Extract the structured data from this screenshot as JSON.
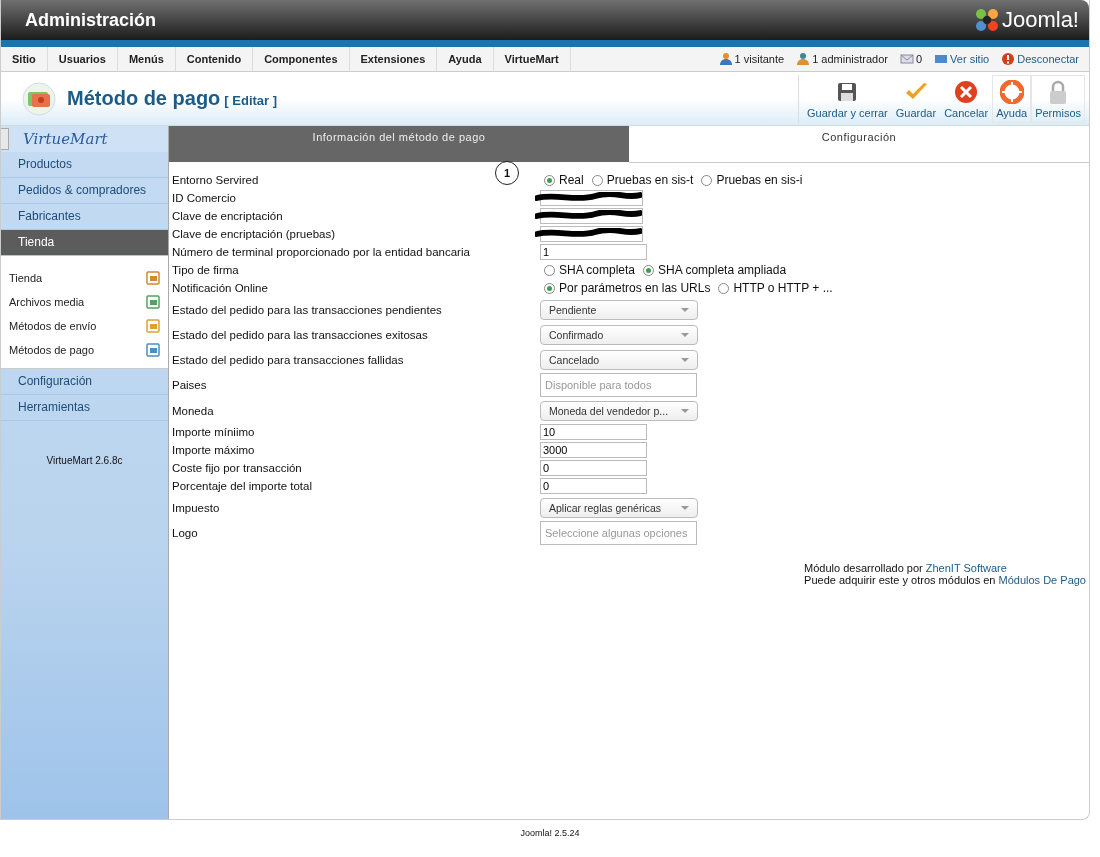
{
  "header": {
    "title": "Administración",
    "logo": "Joomla!"
  },
  "menu": [
    {
      "label": "Sitio"
    },
    {
      "label": "Usuarios"
    },
    {
      "label": "Menús"
    },
    {
      "label": "Contenido"
    },
    {
      "label": "Componentes"
    },
    {
      "label": "Extensiones"
    },
    {
      "label": "Ayuda"
    },
    {
      "label": "VirtueMart"
    }
  ],
  "status": [
    {
      "kind": "users",
      "label": "1 visitante"
    },
    {
      "kind": "admins",
      "label": "1 administrador"
    },
    {
      "kind": "messages",
      "label": "0"
    },
    {
      "kind": "site",
      "label": "Ver sitio"
    },
    {
      "kind": "logout",
      "label": "Desconectar"
    }
  ],
  "toolbar": {
    "title": "Método de pago",
    "subtitle": "[ Editar ]",
    "buttons": [
      {
        "kind": "save-close",
        "label": "Guardar y cerrar"
      },
      {
        "kind": "save",
        "label": "Guardar"
      },
      {
        "kind": "cancel",
        "label": "Cancelar"
      },
      {
        "kind": "help",
        "label": "Ayuda"
      },
      {
        "kind": "permissions",
        "label": "Permisos"
      }
    ]
  },
  "sidebar": {
    "logo": "VirtueMart",
    "items": [
      {
        "label": "Productos",
        "selected": false
      },
      {
        "label": "Pedidos & compradores",
        "selected": false
      },
      {
        "label": "Fabricantes",
        "selected": false
      },
      {
        "label": "Tienda",
        "selected": true,
        "children": [
          {
            "label": "Tienda",
            "kind": "store"
          },
          {
            "label": "Archivos media",
            "kind": "media"
          },
          {
            "label": "Métodos de envío",
            "kind": "shipping"
          },
          {
            "label": "Métodos de pago",
            "kind": "payment"
          }
        ]
      },
      {
        "label": "Configuración",
        "selected": false
      },
      {
        "label": "Herramientas",
        "selected": false
      }
    ],
    "version": "VirtueMart 2.6.8c"
  },
  "tabs": [
    {
      "label": "Información del método de pago",
      "selected": true
    },
    {
      "label": "Configuración",
      "selected": false
    }
  ],
  "annotation": "1",
  "form": [
    {
      "label": "Entorno Servired",
      "kind": "radio",
      "options": [
        {
          "label": "Real",
          "selected": true
        },
        {
          "label": "Pruebas en sis-t",
          "selected": false
        },
        {
          "label": "Pruebas en sis-i",
          "selected": false
        }
      ]
    },
    {
      "label": "ID Comercio",
      "kind": "redacted"
    },
    {
      "label": "Clave de encriptación",
      "kind": "redacted"
    },
    {
      "label": "Clave de encriptación (pruebas)",
      "kind": "redacted"
    },
    {
      "label": "Número de terminal proporcionado por la entidad bancaria",
      "kind": "text",
      "value": "1"
    },
    {
      "label": "Tipo de firma",
      "kind": "radio",
      "options": [
        {
          "label": "SHA completa",
          "selected": false
        },
        {
          "label": "SHA completa ampliada",
          "selected": true
        }
      ]
    },
    {
      "label": "Notificación Online",
      "kind": "radio",
      "options": [
        {
          "label": "Por parámetros en las URLs",
          "selected": true
        },
        {
          "label": "HTTP o HTTP + ...",
          "selected": false
        }
      ]
    },
    {
      "label": "Estado del pedido para las transacciones pendientes",
      "kind": "select",
      "value": "Pendiente"
    },
    {
      "label": "Estado del pedido para las transacciones exitosas",
      "kind": "select",
      "value": "Confirmado"
    },
    {
      "label": "Estado del pedido para transacciones fallidas",
      "kind": "select",
      "value": "Cancelado"
    },
    {
      "label": "Paises",
      "kind": "multi",
      "placeholder": "Disponible para todos"
    },
    {
      "label": "Moneda",
      "kind": "select",
      "value": "Moneda del vendedor p..."
    },
    {
      "label": "Importe míniimo",
      "kind": "text",
      "value": "10"
    },
    {
      "label": "Importe máximo",
      "kind": "text",
      "value": "3000"
    },
    {
      "label": "Coste fijo por transacción",
      "kind": "text",
      "value": "0"
    },
    {
      "label": "Porcentaje del importe total",
      "kind": "text",
      "value": "0"
    },
    {
      "label": "Impuesto",
      "kind": "select",
      "value": "Aplicar reglas genéricas"
    },
    {
      "label": "Logo",
      "kind": "multi",
      "placeholder": "Seleccione algunas opciones"
    }
  ],
  "credits": [
    {
      "text": "Módulo desarrollado por",
      "link": "ZhenIT Software"
    },
    {
      "text": "Puede adquirir este y otros módulos en",
      "link": "Módulos De Pago"
    }
  ],
  "footer": "Joomla! 2.5.24"
}
